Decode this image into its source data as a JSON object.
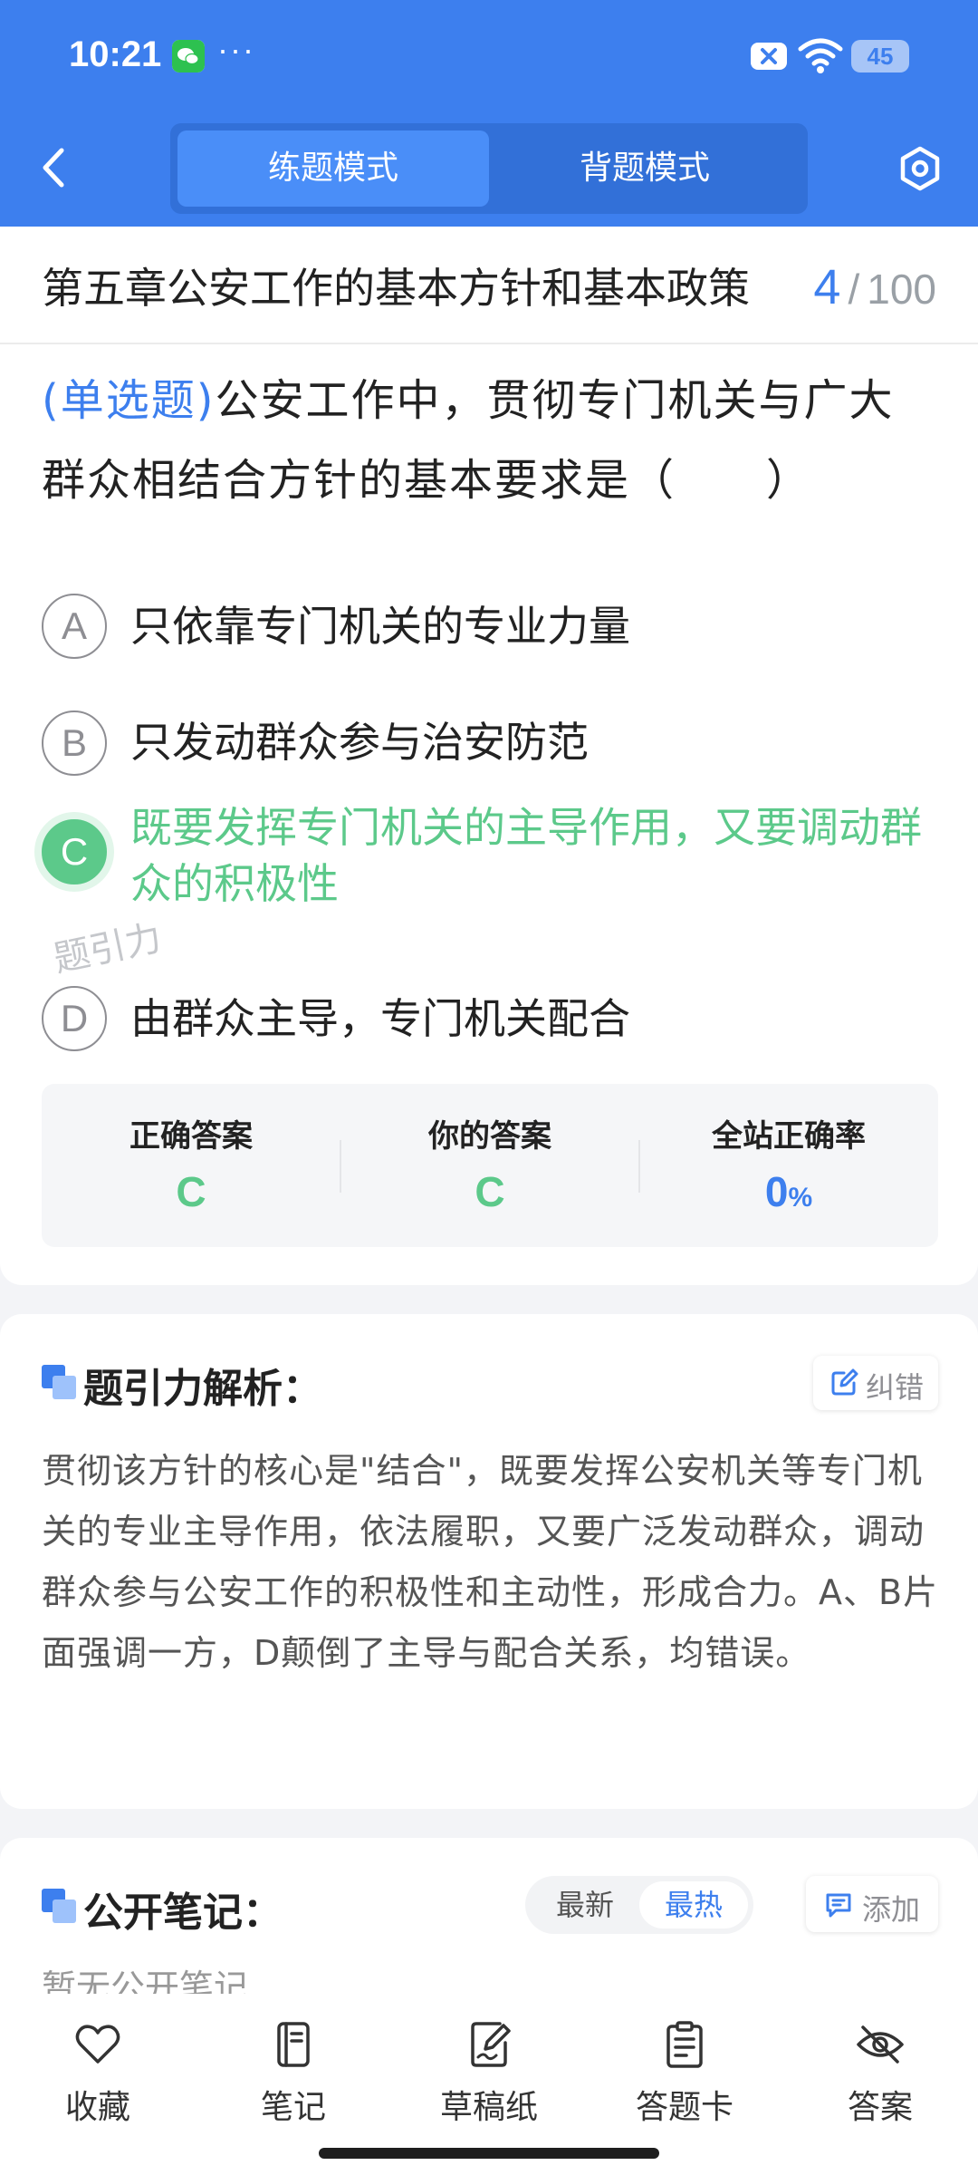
{
  "status_bar": {
    "time": "10:21",
    "more": "···",
    "battery": "45",
    "icons": [
      "wechat-icon",
      "mute-icon",
      "wifi-icon",
      "battery-icon"
    ]
  },
  "header": {
    "back_icon": "chevron-left-icon",
    "tabs": [
      {
        "label": "练题模式",
        "active": true
      },
      {
        "label": "背题模式",
        "active": false
      }
    ],
    "settings_icon": "settings-icon",
    "colors": {
      "primary": "#3d7fee",
      "tab_active": "#4a8ef8",
      "tab_bg": "#3270d8"
    }
  },
  "question": {
    "chapter": "第五章公安工作的基本方针和基本政策",
    "current": "4",
    "separator": "/",
    "total": "100",
    "type_label": "(单选题)",
    "text": "公安工作中，贯彻专门机关与广大群众相结合方针的基本要求是（　　）",
    "options": [
      {
        "letter": "A",
        "text": "只依靠专门机关的专业力量",
        "state": "normal"
      },
      {
        "letter": "B",
        "text": "只发动群众参与治安防范",
        "state": "normal"
      },
      {
        "letter": "C",
        "text": "既要发挥专门机关的主导作用，又要调动群众的积极性",
        "state": "correct"
      },
      {
        "letter": "D",
        "text": "由群众主导，专门机关配合",
        "state": "normal"
      }
    ],
    "correct_color": "#5cc98a"
  },
  "answer_summary": {
    "correct_label": "正确答案",
    "correct_value": "C",
    "yours_label": "你的答案",
    "yours_value": "C",
    "rate_label": "全站正确率",
    "rate_value": "0",
    "rate_unit": "%",
    "watermark": "题引力"
  },
  "analysis": {
    "title": "题引力解析：",
    "correction_label": "纠错",
    "correction_icon": "edit-icon",
    "text": "贯彻该方针的核心是\"结合\"，既要发挥公安机关等专门机关的专业主导作用，依法履职，又要广泛发动群众，调动群众参与公安工作的积极性和主动性，形成合力。A、B片面强调一方，D颠倒了主导与配合关系，均错误。"
  },
  "notes": {
    "title": "公开笔记：",
    "sort_latest": "最新",
    "sort_hot": "最热",
    "sort_active": "最热",
    "add_label": "添加",
    "add_icon": "comment-icon",
    "empty_text": "暂无公开笔记"
  },
  "bottom_nav": [
    {
      "label": "收藏",
      "icon": "heart-icon"
    },
    {
      "label": "笔记",
      "icon": "notebook-icon"
    },
    {
      "label": "草稿纸",
      "icon": "draft-icon"
    },
    {
      "label": "答题卡",
      "icon": "clipboard-icon"
    },
    {
      "label": "答案",
      "icon": "eye-off-icon"
    }
  ]
}
